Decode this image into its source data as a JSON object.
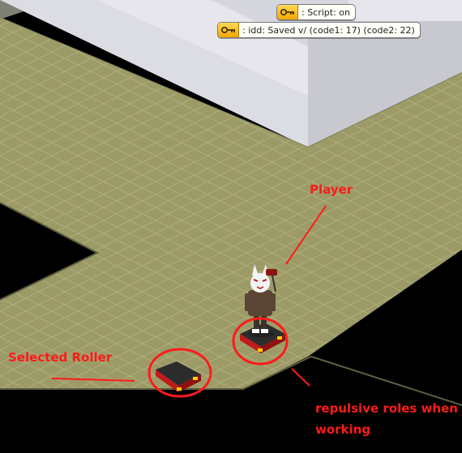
{
  "chat": {
    "script_status": ": Script: on",
    "save_message": ": idd: Saved v/ (code1: 17) (code2: 22)",
    "badge_icon": "key-icon"
  },
  "annotations": {
    "player": "Player",
    "selected_roller": "Selected Roller",
    "repulsive_line1": "repulsive roles when",
    "repulsive_line2": "working"
  },
  "colors": {
    "floor": "#9c9b68",
    "wall_light": "#e6e6ec",
    "wall_shade": "#c8c8d0",
    "annotation": "#ff1a1a"
  }
}
